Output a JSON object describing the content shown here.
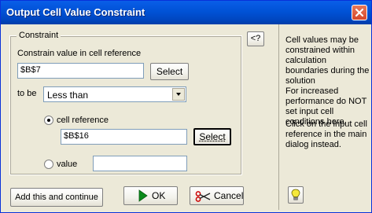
{
  "window": {
    "title": "Output Cell Value Constraint"
  },
  "constraint": {
    "legend": "Constraint",
    "cell_ref_label": "Constrain value in cell reference",
    "cell_ref_value": "$B$7",
    "select_label": "Select",
    "tobe_label": "to be",
    "operator_value": "Less than",
    "radio_cell_label": "cell reference",
    "target_ref_value": "$B$16",
    "target_select_label": "Select",
    "radio_value_label": "value",
    "value_input_value": ""
  },
  "buttons": {
    "add_continue": "Add this and continue",
    "ok": "OK",
    "cancel": "Cancel",
    "help_toggle": "<?"
  },
  "help_panel": {
    "para1": "Cell values may be constrained within calculation boundaries during the solution",
    "para2": "For increased performance do NOT set input cell conditions here.",
    "para3": "Click on the input cell reference in the main dialog instead."
  },
  "icons": [
    "close-icon",
    "dropdown-arrow-icon",
    "ok-arrow-icon",
    "cancel-scissors-icon",
    "help-bulb-icon"
  ]
}
